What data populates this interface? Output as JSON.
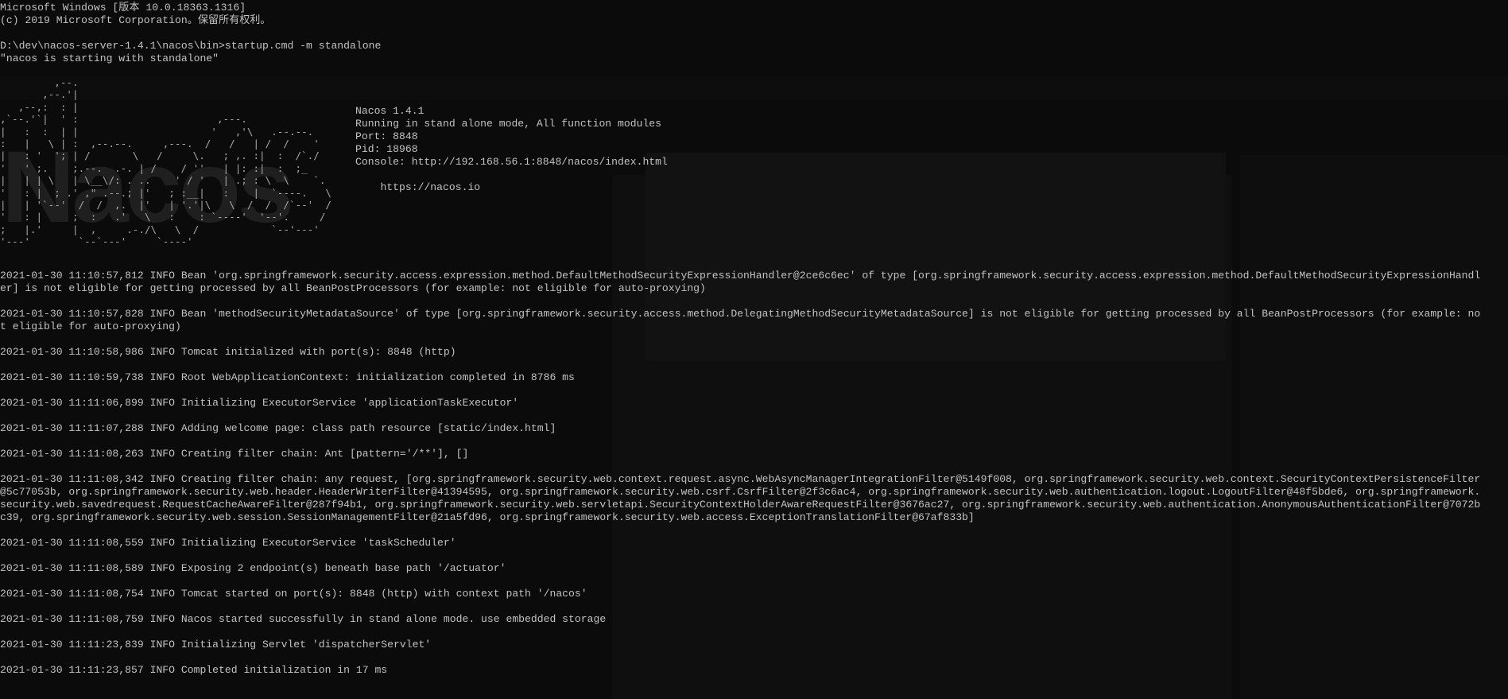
{
  "console": {
    "header_line1": "Microsoft Windows [版本 10.0.18363.1316]",
    "header_line2": "(c) 2019 Microsoft Corporation。保留所有权利。",
    "prompt_line": "D:\\dev\\nacos-server-1.4.1\\nacos\\bin>startup.cmd -m standalone",
    "starting_line": "\"nacos is starting with standalone\""
  },
  "banner": {
    "word": "Nacos",
    "version": "Nacos 1.4.1",
    "mode": "Running in stand alone mode, All function modules",
    "port": "Port: 8848",
    "pid": "Pid: 18968",
    "console_url": "Console: http://192.168.56.1:8848/nacos/index.html",
    "site": "https://nacos.io"
  },
  "log": [
    {
      "line1": "2021-01-30 11:10:57,812 INFO Bean 'org.springframework.security.access.expression.method.DefaultMethodSecurityExpressionHandler@2ce6c6ec' of type [org.springframework.security.access.expression.method.DefaultMethodSecurityExpressionHandl",
      "line2": "er] is not eligible for getting processed by all BeanPostProcessors (for example: not eligible for auto-proxying)"
    },
    {
      "line1": "2021-01-30 11:10:57,828 INFO Bean 'methodSecurityMetadataSource' of type [org.springframework.security.access.method.DelegatingMethodSecurityMetadataSource] is not eligible for getting processed by all BeanPostProcessors (for example: no",
      "line2": "t eligible for auto-proxying)"
    },
    {
      "line1": "2021-01-30 11:10:58,986 INFO Tomcat initialized with port(s): 8848 (http)"
    },
    {
      "line1": "2021-01-30 11:10:59,738 INFO Root WebApplicationContext: initialization completed in 8786 ms"
    },
    {
      "line1": "2021-01-30 11:11:06,899 INFO Initializing ExecutorService 'applicationTaskExecutor'"
    },
    {
      "line1": "2021-01-30 11:11:07,288 INFO Adding welcome page: class path resource [static/index.html]"
    },
    {
      "line1": "2021-01-30 11:11:08,263 INFO Creating filter chain: Ant [pattern='/**'], []"
    },
    {
      "line1": "2021-01-30 11:11:08,342 INFO Creating filter chain: any request, [org.springframework.security.web.context.request.async.WebAsyncManagerIntegrationFilter@5149f008, org.springframework.security.web.context.SecurityContextPersistenceFilter",
      "line2": "@5c77053b, org.springframework.security.web.header.HeaderWriterFilter@41394595, org.springframework.security.web.csrf.CsrfFilter@2f3c6ac4, org.springframework.security.web.authentication.logout.LogoutFilter@48f5bde6, org.springframework.",
      "line3": "security.web.savedrequest.RequestCacheAwareFilter@287f94b1, org.springframework.security.web.servletapi.SecurityContextHolderAwareRequestFilter@3676ac27, org.springframework.security.web.authentication.AnonymousAuthenticationFilter@7072b",
      "line4": "c39, org.springframework.security.web.session.SessionManagementFilter@21a5fd96, org.springframework.security.web.access.ExceptionTranslationFilter@67af833b]"
    },
    {
      "line1": "2021-01-30 11:11:08,559 INFO Initializing ExecutorService 'taskScheduler'"
    },
    {
      "line1": "2021-01-30 11:11:08,589 INFO Exposing 2 endpoint(s) beneath base path '/actuator'"
    },
    {
      "line1": "2021-01-30 11:11:08,754 INFO Tomcat started on port(s): 8848 (http) with context path '/nacos'"
    },
    {
      "line1": "2021-01-30 11:11:08,759 INFO Nacos started successfully in stand alone mode. use embedded storage"
    },
    {
      "line1": "2021-01-30 11:11:23,839 INFO Initializing Servlet 'dispatcherServlet'"
    },
    {
      "line1": "2021-01-30 11:11:23,857 INFO Completed initialization in 17 ms"
    }
  ],
  "colors": {
    "background": "#0c0c0c",
    "text": "#c2c2c2"
  }
}
